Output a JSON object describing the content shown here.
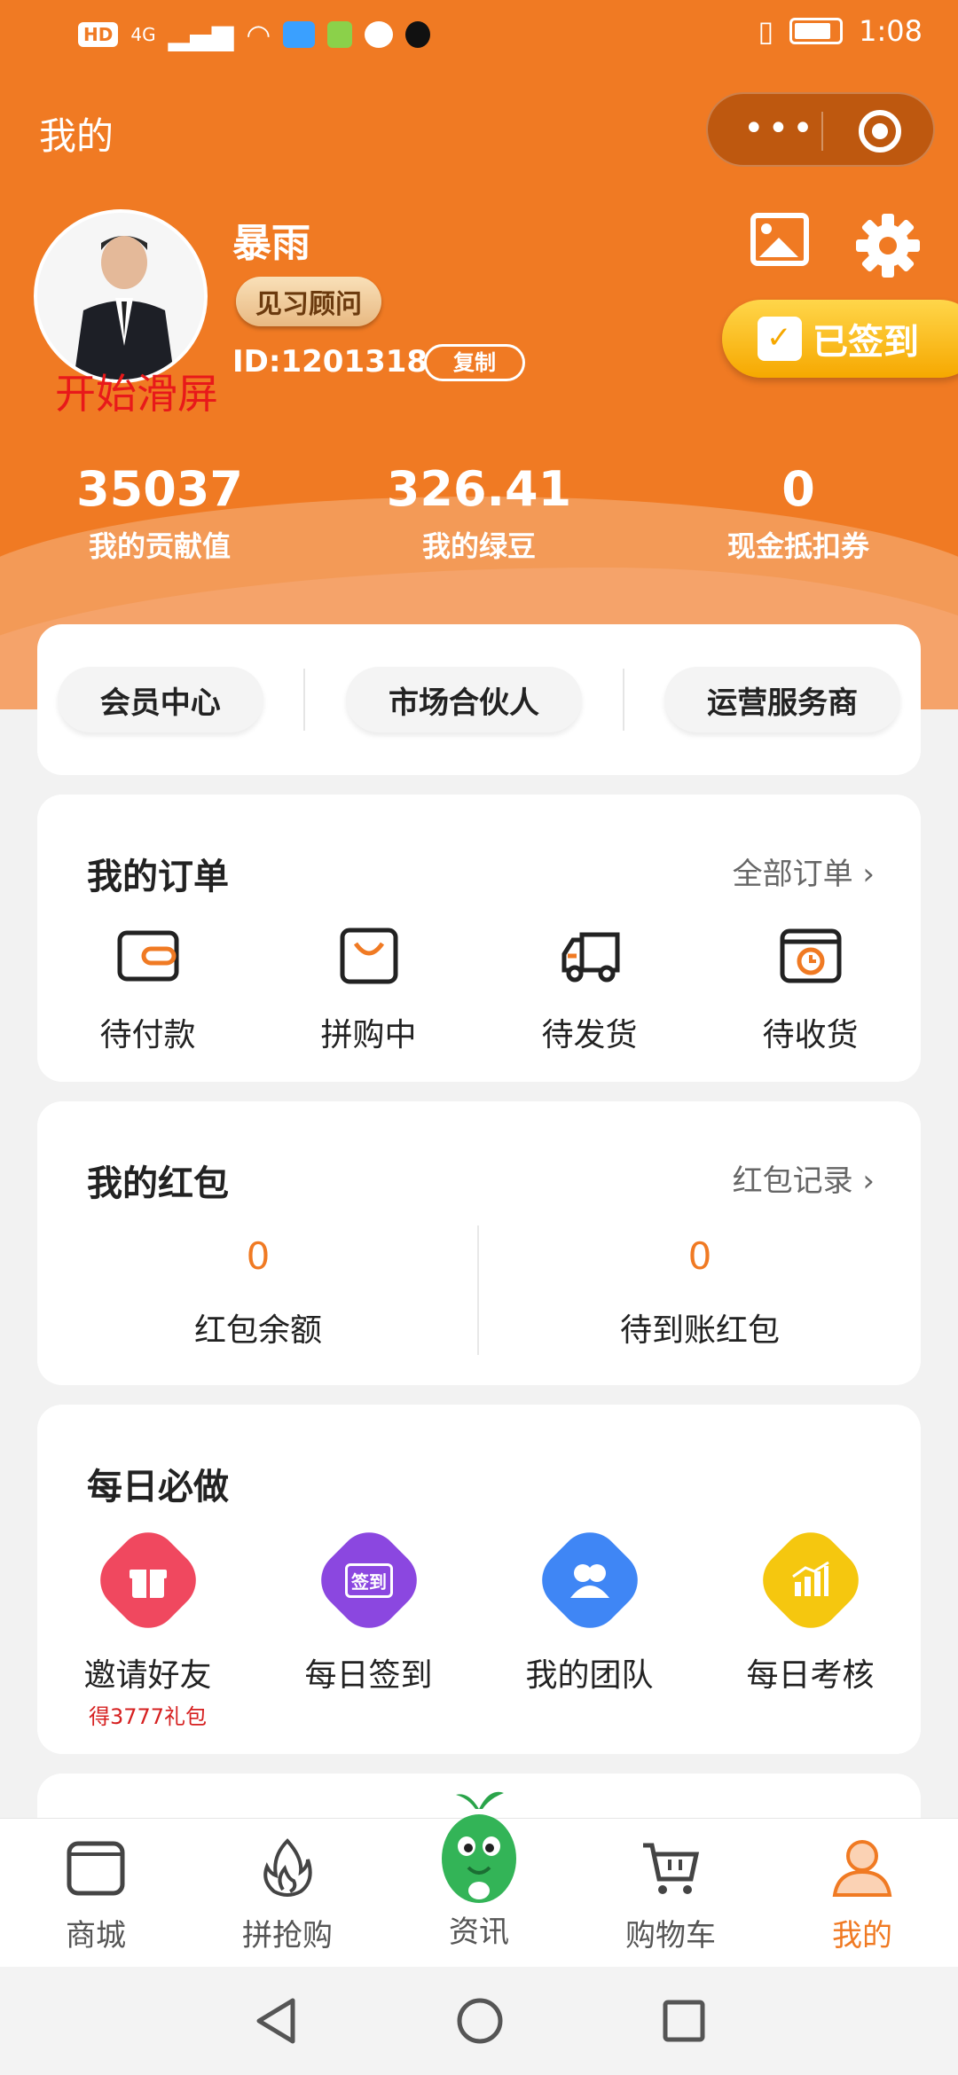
{
  "status_bar": {
    "time": "1:08",
    "left_chip": "HD",
    "signal": "4G"
  },
  "header": {
    "title": "我的"
  },
  "profile": {
    "name": "暴雨",
    "role": "见习顾问",
    "id_text": "ID:1201318",
    "copy_label": "复制",
    "overlay_text": "开始滑屏",
    "signed_label": "已签到"
  },
  "stats": [
    {
      "value": "35037",
      "label": "我的贡献值"
    },
    {
      "value": "326.41",
      "label": "我的绿豆"
    },
    {
      "value": "0",
      "label": "现金抵扣券"
    }
  ],
  "member_tabs": [
    "会员中心",
    "市场合伙人",
    "运营服务商"
  ],
  "orders": {
    "title": "我的订单",
    "more": "全部订单 ›",
    "items": [
      {
        "label": "待付款",
        "icon": "wallet-icon"
      },
      {
        "label": "拼购中",
        "icon": "shopping-bag-icon"
      },
      {
        "label": "待发货",
        "icon": "truck-icon"
      },
      {
        "label": "待收货",
        "icon": "package-clock-icon"
      }
    ]
  },
  "red_packet": {
    "title": "我的红包",
    "more": "红包记录 ›",
    "balance_value": "0",
    "balance_label": "红包余额",
    "pending_value": "0",
    "pending_label": "待到账红包"
  },
  "daily": {
    "title": "每日必做",
    "items": [
      {
        "label": "邀请好友",
        "sub": "得3777礼包",
        "icon": "gift-icon",
        "color": "#f0485f"
      },
      {
        "label": "每日签到",
        "icon_text": "签到",
        "icon": "checkin-icon",
        "color": "#8b47e0"
      },
      {
        "label": "我的团队",
        "icon": "team-icon",
        "color": "#3f86f5"
      },
      {
        "label": "每日考核",
        "icon": "chart-icon",
        "color": "#f5c70f"
      }
    ]
  },
  "tabbar": [
    {
      "label": "商城",
      "icon": "store-icon"
    },
    {
      "label": "拼抢购",
      "icon": "flame-icon"
    },
    {
      "label": "资讯",
      "icon": "mascot-icon"
    },
    {
      "label": "购物车",
      "icon": "cart-icon"
    },
    {
      "label": "我的",
      "icon": "user-icon",
      "active": true
    }
  ],
  "colors": {
    "brand": "#f07a23",
    "gold": "#f6a800"
  }
}
